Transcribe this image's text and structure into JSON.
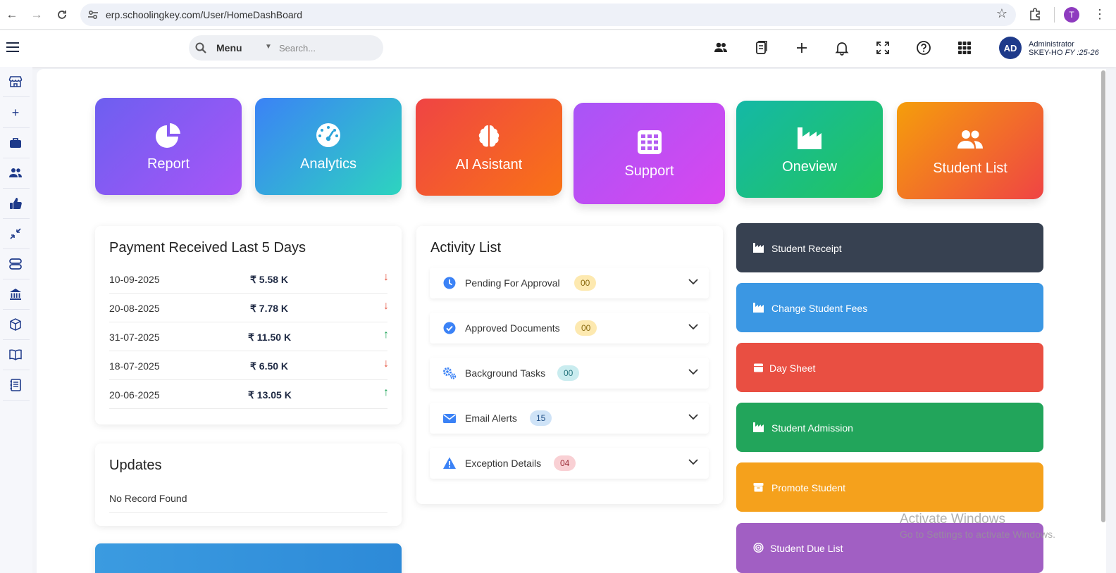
{
  "browser": {
    "url": "erp.schoolingkey.com/User/HomeDashBoard",
    "profile_initial": "T"
  },
  "header": {
    "menu_label": "Menu",
    "search_placeholder": "Search...",
    "avatar_initials": "AD",
    "user_role": "Administrator",
    "school_code": "SKEY-HO",
    "fiscal_year": "FY :25-26",
    "icons": [
      "users-icon",
      "documents-icon",
      "plus-icon",
      "bell-icon",
      "fullscreen-icon",
      "help-icon",
      "apps-grid-icon"
    ]
  },
  "sidebar": {
    "icons": [
      "store-icon",
      "plus-icon",
      "briefcase-icon",
      "users-icon",
      "thumbs-up-icon",
      "collapse-icon",
      "server-icon",
      "bank-icon",
      "box-icon",
      "book-icon",
      "notebook-icon"
    ]
  },
  "tiles": [
    {
      "label": "Report",
      "icon": "pie-chart-icon",
      "colors": [
        "#6d5ff0",
        "#a855f7"
      ]
    },
    {
      "label": "Analytics",
      "icon": "gauge-icon",
      "colors": [
        "#3b82f6",
        "#2dd4bf"
      ]
    },
    {
      "label": "AI Asistant",
      "icon": "brain-icon",
      "colors": [
        "#ef4444",
        "#f97316"
      ]
    },
    {
      "label": "Support",
      "icon": "calendar-grid-icon",
      "colors": [
        "#a855f7",
        "#d946ef"
      ]
    },
    {
      "label": "Oneview",
      "icon": "factory-icon",
      "colors": [
        "#14b8a6",
        "#22c55e"
      ]
    },
    {
      "label": "Student List",
      "icon": "users-icon",
      "colors": [
        "#f59e0b",
        "#ef4444"
      ]
    }
  ],
  "payments": {
    "title": "Payment Received Last 5 Days",
    "rows": [
      {
        "date": "10-09-2025",
        "amount": "₹ 5.58 K",
        "trend": "down"
      },
      {
        "date": "20-08-2025",
        "amount": "₹ 7.78 K",
        "trend": "down"
      },
      {
        "date": "31-07-2025",
        "amount": "₹ 11.50 K",
        "trend": "up"
      },
      {
        "date": "18-07-2025",
        "amount": "₹ 6.50 K",
        "trend": "down"
      },
      {
        "date": "20-06-2025",
        "amount": "₹ 13.05 K",
        "trend": "up"
      }
    ]
  },
  "updates": {
    "title": "Updates",
    "empty_text": "No Record Found"
  },
  "activity": {
    "title": "Activity List",
    "items": [
      {
        "label": "Pending For Approval",
        "count": "00",
        "icon": "clock-icon",
        "badge_bg": "#fde9b0",
        "badge_fg": "#8a6a10"
      },
      {
        "label": "Approved Documents",
        "count": "00",
        "icon": "check-circle-icon",
        "badge_bg": "#fde9b0",
        "badge_fg": "#8a6a10"
      },
      {
        "label": "Background Tasks",
        "count": "00",
        "icon": "gears-icon",
        "badge_bg": "#c9ecef",
        "badge_fg": "#24747c"
      },
      {
        "label": "Email Alerts",
        "count": "15",
        "icon": "envelope-icon",
        "badge_bg": "#cfe3f7",
        "badge_fg": "#1f4f86"
      },
      {
        "label": "Exception Details",
        "count": "04",
        "icon": "warning-icon",
        "badge_bg": "#f9d0d4",
        "badge_fg": "#9b2c36"
      }
    ]
  },
  "quick_links": [
    {
      "label": "Student Receipt",
      "icon": "industry-icon",
      "color": "#374151"
    },
    {
      "label": "Change Student Fees",
      "icon": "industry-icon",
      "color": "#3b97e3"
    },
    {
      "label": "Day Sheet",
      "icon": "calendar-icon",
      "color": "#e94f42"
    },
    {
      "label": "Student Admission",
      "icon": "industry-icon",
      "color": "#22a55b"
    },
    {
      "label": "Promote Student",
      "icon": "archive-icon",
      "color": "#f5a11c"
    },
    {
      "label": "Student Due List",
      "icon": "target-icon",
      "color": "#a15fc3"
    }
  ],
  "watermark": {
    "title": "Activate Windows",
    "subtitle": "Go to Settings to activate Windows."
  }
}
